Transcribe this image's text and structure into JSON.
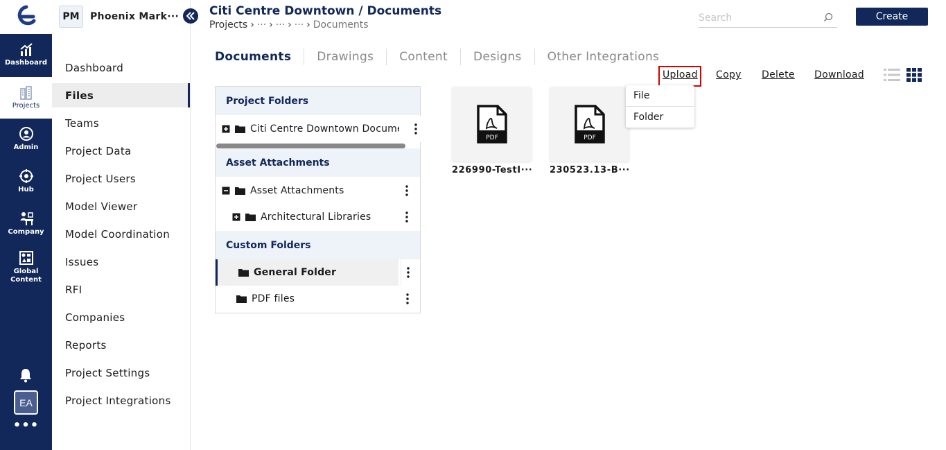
{
  "app": {
    "rail": [
      {
        "label": "Dashboard",
        "icon": "dashboard-icon"
      },
      {
        "label": "Projects",
        "icon": "projects-icon"
      },
      {
        "label": "Admin",
        "icon": "admin-icon"
      },
      {
        "label": "Hub",
        "icon": "hub-icon"
      },
      {
        "label": "Company",
        "icon": "company-icon"
      },
      {
        "label": "Global Content",
        "icon": "global-content-icon"
      }
    ],
    "user_initials": "EA",
    "more": "•••"
  },
  "project": {
    "badge": "PM",
    "name": "Phoenix Mark···"
  },
  "sidebar": {
    "items": [
      "Dashboard",
      "Files",
      "Teams",
      "Project Data",
      "Project Users",
      "Model Viewer",
      "Model Coordination",
      "Issues",
      "RFI",
      "Companies",
      "Reports",
      "Project Settings",
      "Project Integrations"
    ],
    "active": "Files"
  },
  "header": {
    "title": "Citi Centre Downtown / Documents",
    "crumbs": [
      "Projects",
      "···",
      "···",
      "···",
      "Documents"
    ],
    "search_placeholder": "Search",
    "create_label": "Create"
  },
  "tabs": [
    "Documents",
    "Drawings",
    "Content",
    "Designs",
    "Other Integrations"
  ],
  "actions": {
    "upload": "Upload",
    "copy": "Copy",
    "delete": "Delete",
    "download": "Download"
  },
  "upload_menu": [
    "File",
    "Folder"
  ],
  "tree": {
    "sections": {
      "project": "Project Folders",
      "asset": "Asset Attachments",
      "custom": "Custom Folders"
    },
    "rows": {
      "project_root": "Citi Centre Downtown Documents",
      "asset_root": "Asset Attachments",
      "asset_child": "Architectural Libraries",
      "general": "General Folder",
      "pdf": "PDF files"
    }
  },
  "files": [
    {
      "name": "226990-TestI···",
      "type": "PDF"
    },
    {
      "name": "230523.13-B···",
      "type": "PDF"
    }
  ],
  "colors": {
    "brand": "#12285a",
    "highlight": "#d60000"
  }
}
